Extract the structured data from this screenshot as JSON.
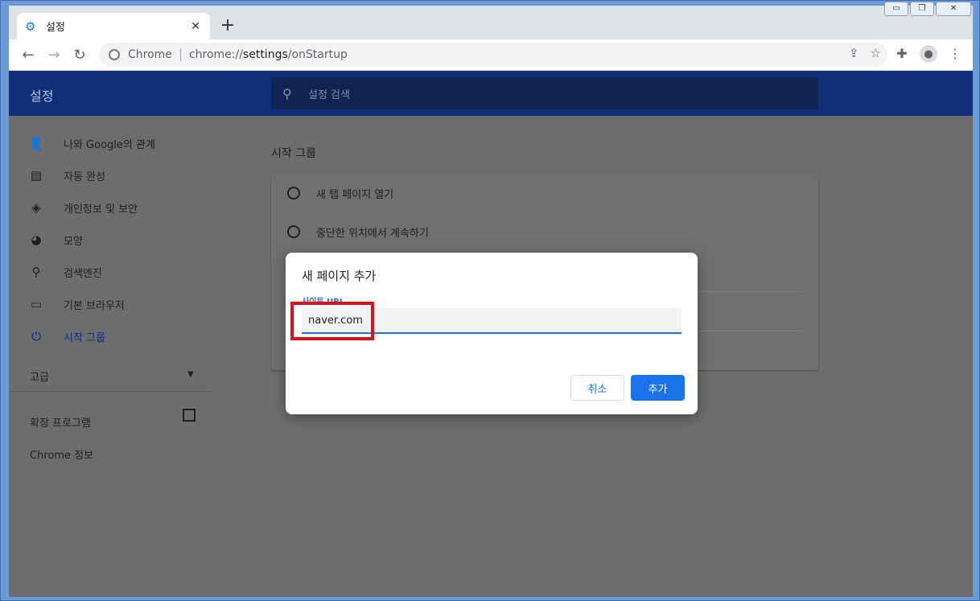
{
  "tab": {
    "title": "설정",
    "close": "✕",
    "new_tab": "+"
  },
  "window_controls": {
    "minimize": "▭",
    "restore": "❐",
    "close": "✕"
  },
  "toolbar": {
    "back": "←",
    "forward": "→",
    "reload": "↻",
    "omnibox": {
      "site_label": "Chrome",
      "url_prefix": "chrome://",
      "url_host": "settings",
      "url_path": "/onStartup"
    }
  },
  "header": {
    "title": "설정",
    "search_placeholder": "설정 검색"
  },
  "sidebar": {
    "items": [
      {
        "label": "나와 Google의 관계",
        "icon": "person-icon"
      },
      {
        "label": "자동 완성",
        "icon": "clipboard-icon"
      },
      {
        "label": "개인정보 및 보안",
        "icon": "shield-icon"
      },
      {
        "label": "모양",
        "icon": "palette-icon"
      },
      {
        "label": "검색엔진",
        "icon": "search-icon"
      },
      {
        "label": "기본 브라우저",
        "icon": "browser-icon"
      },
      {
        "label": "시작 그룹",
        "icon": "power-icon",
        "active": true
      }
    ],
    "advanced": "고급",
    "extensions": "확장 프로그램",
    "about": "Chrome 정보"
  },
  "main": {
    "section_title": "시작 그룹",
    "options": [
      "새 탭 페이지 열기",
      "중단한 위치에서 계속하기"
    ]
  },
  "dialog": {
    "title": "새 페이지 추가",
    "field_label": "사이트 URL",
    "field_value": "naver.com",
    "cancel_label": "취소",
    "add_label": "추가"
  },
  "colors": {
    "header": "#0f2f7a",
    "accent": "#1a73e8",
    "highlight": "#e0101a"
  }
}
